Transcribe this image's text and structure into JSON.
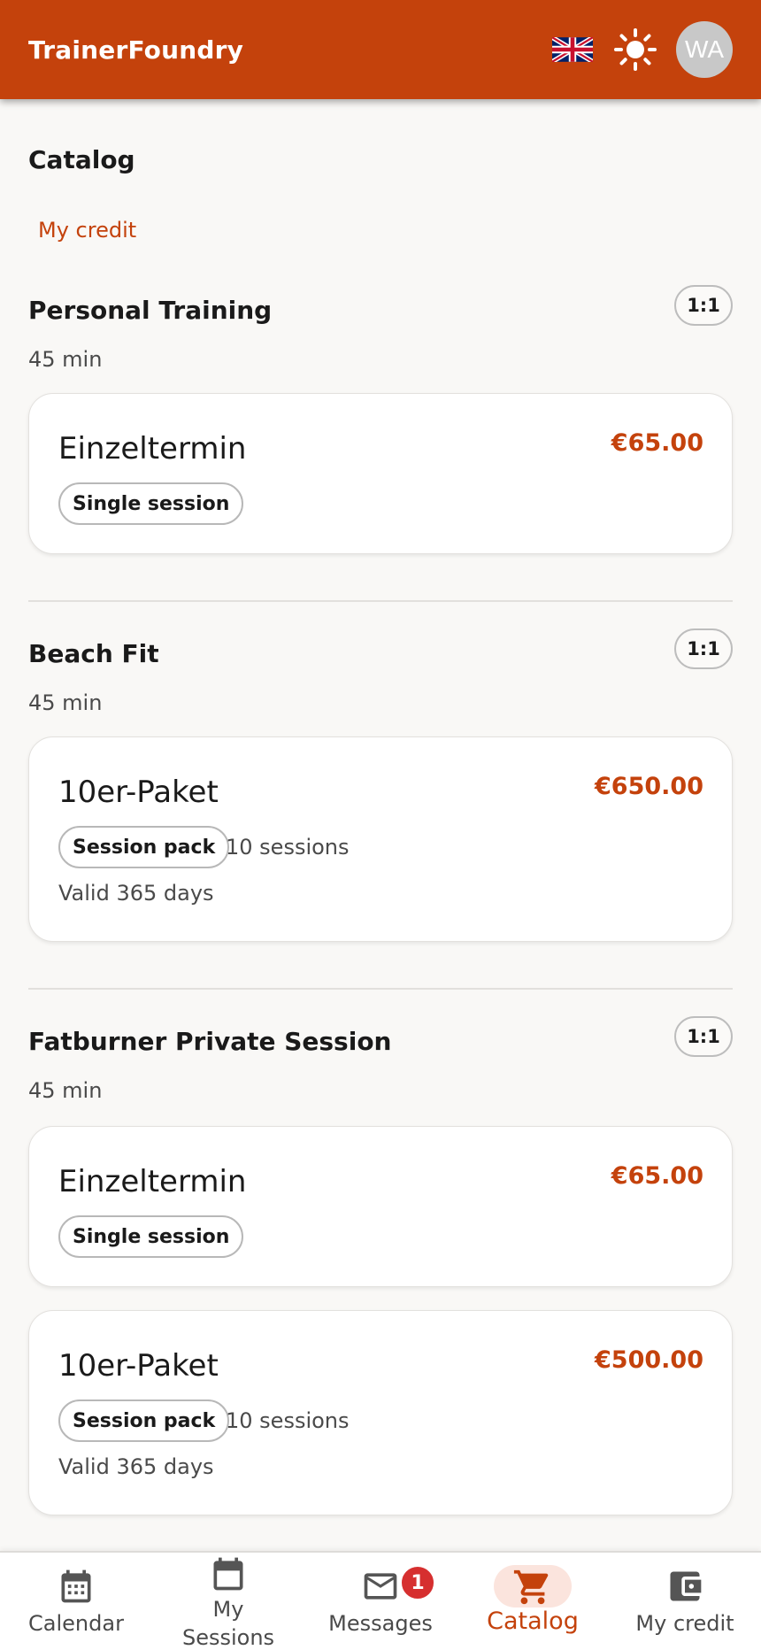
{
  "header": {
    "brand": "TrainerFoundry",
    "avatar_initials": "WA",
    "accent_color": "#c4420c",
    "language_icon": "uk-flag-icon",
    "theme_icon": "sun-icon"
  },
  "page": {
    "title": "Catalog",
    "credit_link": "My credit"
  },
  "sections": [
    {
      "title": "Personal Training",
      "badge": "1:1",
      "duration": "45 min",
      "offers": [
        {
          "name": "Einzeltermin",
          "price": "€65.00",
          "type": "Single session"
        }
      ]
    },
    {
      "title": "Beach Fit",
      "badge": "1:1",
      "duration": "45 min",
      "offers": [
        {
          "name": "10er-Paket",
          "price": "€650.00",
          "type": "Session pack",
          "sessions": "10 sessions",
          "validity": "Valid 365 days"
        }
      ]
    },
    {
      "title": "Fatburner Private Session",
      "badge": "1:1",
      "duration": "45 min",
      "offers": [
        {
          "name": "Einzeltermin",
          "price": "€65.00",
          "type": "Single session"
        },
        {
          "name": "10er-Paket",
          "price": "€500.00",
          "type": "Session pack",
          "sessions": "10 sessions",
          "validity": "Valid 365 days"
        }
      ]
    }
  ],
  "bottom_nav": {
    "items": [
      {
        "label": "Calendar",
        "icon": "calendar-icon"
      },
      {
        "label_line1": "My",
        "label_line2": "Sessions",
        "icon": "calendar-event-icon"
      },
      {
        "label": "Messages",
        "icon": "mail-icon",
        "badge": "1"
      },
      {
        "label": "Catalog",
        "icon": "cart-icon",
        "active": true
      },
      {
        "label": "My credit",
        "icon": "wallet-icon"
      }
    ]
  }
}
